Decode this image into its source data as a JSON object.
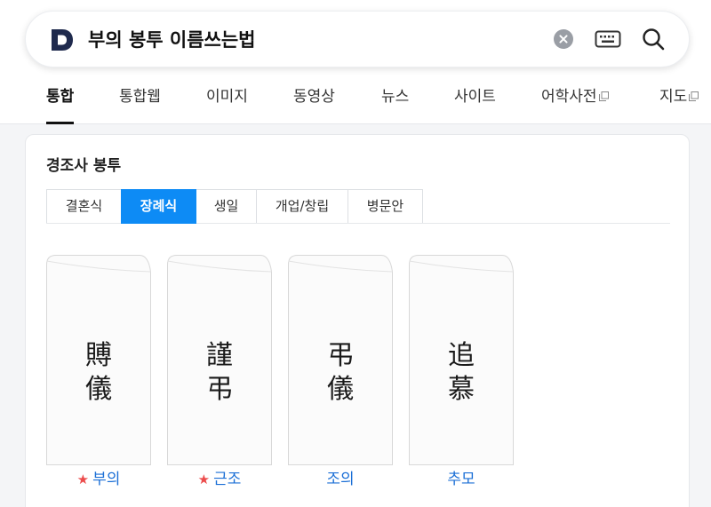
{
  "search": {
    "query": "부의 봉투 이름쓰는법",
    "logo_icon": "daum-d-logo",
    "clear_icon": "clear-x-icon",
    "keyboard_icon": "keyboard-icon",
    "search_icon": "magnifier-icon"
  },
  "tabs": [
    {
      "label": "통합",
      "active": true
    },
    {
      "label": "통합웹"
    },
    {
      "label": "이미지"
    },
    {
      "label": "동영상"
    },
    {
      "label": "뉴스"
    },
    {
      "label": "사이트"
    },
    {
      "label": "어학사전",
      "external": true
    },
    {
      "label": "지도",
      "external": true
    }
  ],
  "card": {
    "title": "경조사 봉투",
    "segments": [
      {
        "label": "결혼식"
      },
      {
        "label": "장례식",
        "active": true
      },
      {
        "label": "생일"
      },
      {
        "label": "개업/창립"
      },
      {
        "label": "병문안"
      }
    ],
    "envelopes": [
      {
        "line1": "賻",
        "line2": "儀",
        "label": "부의",
        "starred": true
      },
      {
        "line1": "謹",
        "line2": "弔",
        "label": "근조",
        "starred": true
      },
      {
        "line1": "弔",
        "line2": "儀",
        "label": "조의",
        "starred": false
      },
      {
        "line1": "追",
        "line2": "慕",
        "label": "추모",
        "starred": false
      }
    ],
    "star_glyph": "★"
  },
  "colors": {
    "accent_blue": "#0d8bf5",
    "link_blue": "#1b6fd6",
    "star_red": "#ec4b4b",
    "logo_navy": "#1f2a4d"
  }
}
